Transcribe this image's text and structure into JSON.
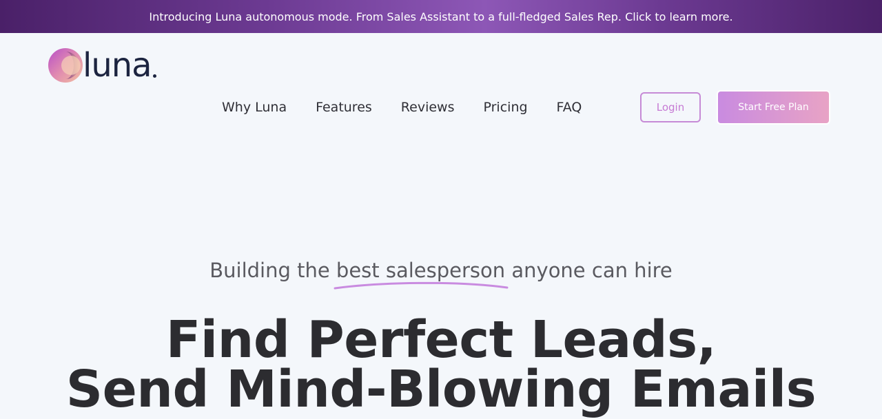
{
  "announcement": {
    "text": "Introducing Luna autonomous mode. From Sales Assistant to a full-fledged Sales Rep. Click to learn more."
  },
  "logo": {
    "wordmark": "luna"
  },
  "nav": {
    "items": [
      {
        "label": "Why Luna"
      },
      {
        "label": "Features"
      },
      {
        "label": "Reviews"
      },
      {
        "label": "Pricing"
      },
      {
        "label": "FAQ"
      }
    ],
    "login_label": "Login",
    "start_label": "Start Free Plan"
  },
  "hero": {
    "tagline_before": "Building the ",
    "tagline_highlight": "best salesperson",
    "tagline_after": " anyone can hire",
    "headline_line1": "Find Perfect Leads,",
    "headline_line2": "Send Mind-Blowing Emails"
  },
  "colors": {
    "accent": "#c68ad6",
    "announce_bg": "#6c3a92",
    "text_dark": "#2c2c30"
  }
}
